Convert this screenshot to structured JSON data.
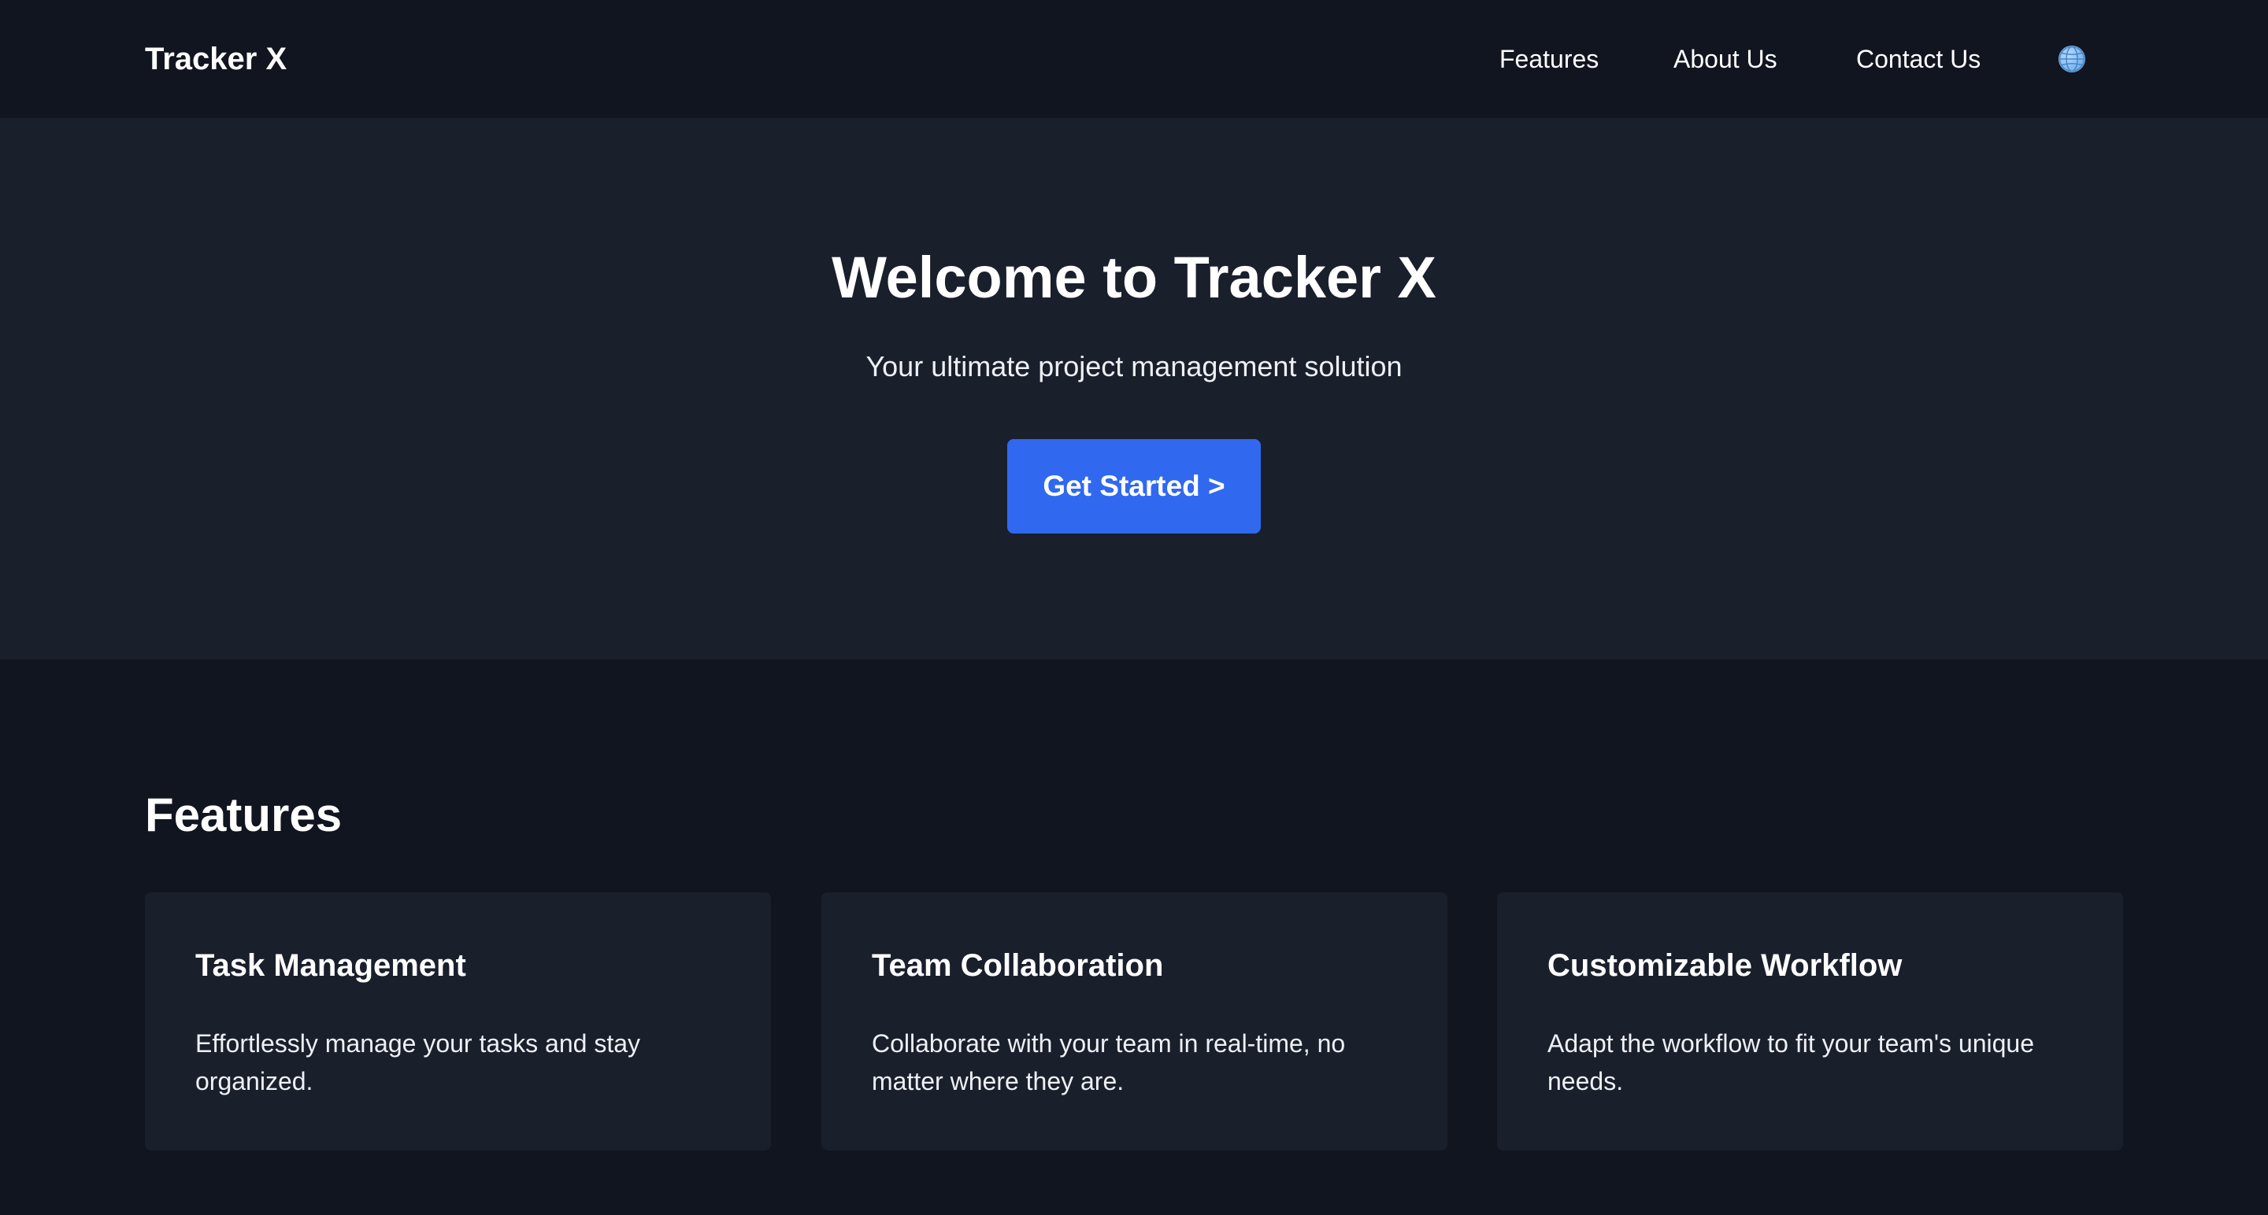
{
  "navbar": {
    "brand": "Tracker X",
    "links": [
      {
        "label": "Features"
      },
      {
        "label": "About Us"
      },
      {
        "label": "Contact Us"
      }
    ],
    "language_icon": "globe-icon"
  },
  "hero": {
    "title": "Welcome to Tracker X",
    "subtitle": "Your ultimate project management solution",
    "cta_label": "Get Started >"
  },
  "features": {
    "heading": "Features",
    "cards": [
      {
        "title": "Task Management",
        "text": "Effortlessly manage your tasks and stay organized."
      },
      {
        "title": "Team Collaboration",
        "text": "Collaborate with your team in real-time, no matter where they are."
      },
      {
        "title": "Customizable Workflow",
        "text": "Adapt the workflow to fit your team's unique needs."
      }
    ]
  },
  "colors": {
    "page_background": "#111520",
    "section_background": "#1a1f2c",
    "accent": "#3069f0",
    "text": "#ffffff"
  }
}
